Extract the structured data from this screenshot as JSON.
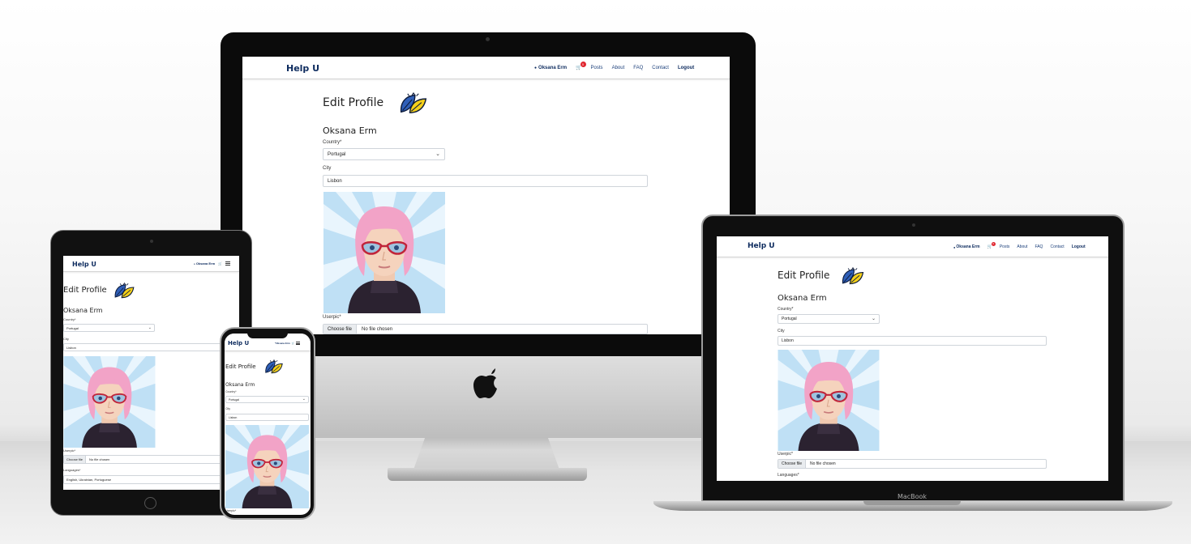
{
  "site": {
    "brand": "Help U",
    "nav": {
      "user": "Oksana Erm",
      "cart_count": "0",
      "links": [
        "Posts",
        "About",
        "FAQ",
        "Contact"
      ],
      "logout": "Logout"
    }
  },
  "profile": {
    "title": "Edit Profile",
    "name": "Oksana Erm",
    "country_label": "Country*",
    "country_value": "Portugal",
    "city_label": "City",
    "city_value": "Lisbon",
    "userpic_label": "Userpic*",
    "file_button": "Choose file",
    "file_status": "No file chosen",
    "languages_label": "Languages*",
    "languages_value": "English, Ukrainian, Portuguese"
  },
  "device_labels": {
    "macbook": "MacBook"
  },
  "colors": {
    "brand": "#0d2b5e",
    "nav_link": "#1b3f7a",
    "badge": "#e0262f",
    "leaf_blue": "#2f5fb8",
    "leaf_yellow": "#f5d019"
  },
  "icons": [
    "user-icon",
    "cart-icon",
    "hamburger-icon",
    "leaf-logo-icon",
    "chevron-down-icon",
    "apple-logo-icon"
  ]
}
